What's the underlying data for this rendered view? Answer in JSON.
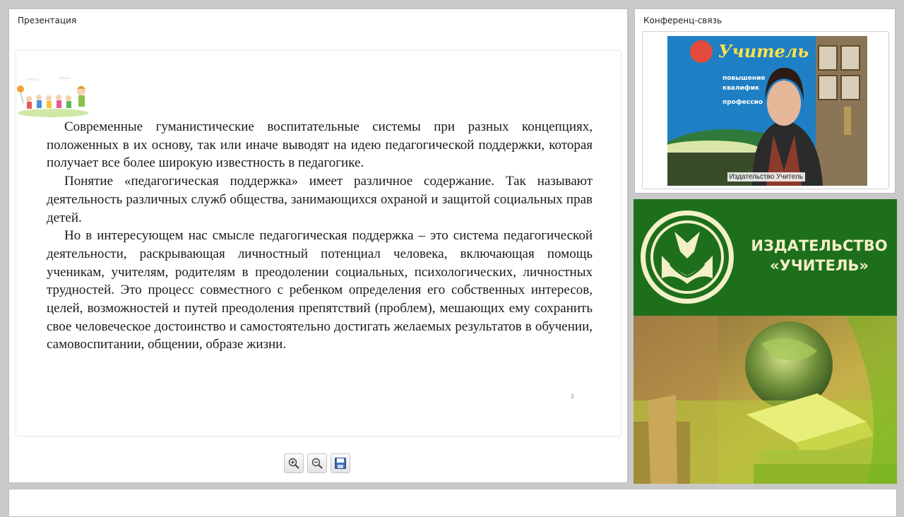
{
  "presentation": {
    "title": "Презентация",
    "slide": {
      "paragraphs": [
        "Современные гуманистические воспитательные системы при разных концепциях, положенных в их основу, так или иначе выводят на идею педагогической поддержки, которая получает все более широкую известность в педагогике.",
        "Понятие «педагогическая поддержка» имеет различное содержание. Так называют деятельность различных служб общества, занимающихся охраной и защитой социальных прав детей.",
        "Но в интересующем нас смысле педагогическая поддержка – это система педагогической деятельности, раскрывающая личностный потенциал человека, включающая помощь ученикам, учителям, родителям в преодолении социальных, психологических, личностных трудностей. Это процесс совместного с ребенком определения его собственных интересов, целей, возможностей и путей преодоления препятствий (проблем), мешающих ему сохранить свое человеческое достоинство и самостоятельно достигать желаемых результатов в обучении, самовоспитании, общении, образе жизни."
      ],
      "page_number": "3"
    },
    "toolbar": {
      "icons": [
        "zoom-in-icon",
        "zoom-out-icon",
        "save-icon"
      ]
    }
  },
  "conference": {
    "title": "Конференц-связь",
    "participant_name": "Издательство Учитель",
    "backdrop_text": {
      "brand": "Учитель",
      "line1": "повышение",
      "line2": "квалифик",
      "line3": "профессио"
    }
  },
  "banner": {
    "title_line1": "ИЗДАТЕЛЬСТВО",
    "title_line2": "«УЧИТЕЛЬ»",
    "colors": {
      "green": "#1d6f1b",
      "cream": "#f3f0c8",
      "lime": "#9ccc2a"
    }
  }
}
